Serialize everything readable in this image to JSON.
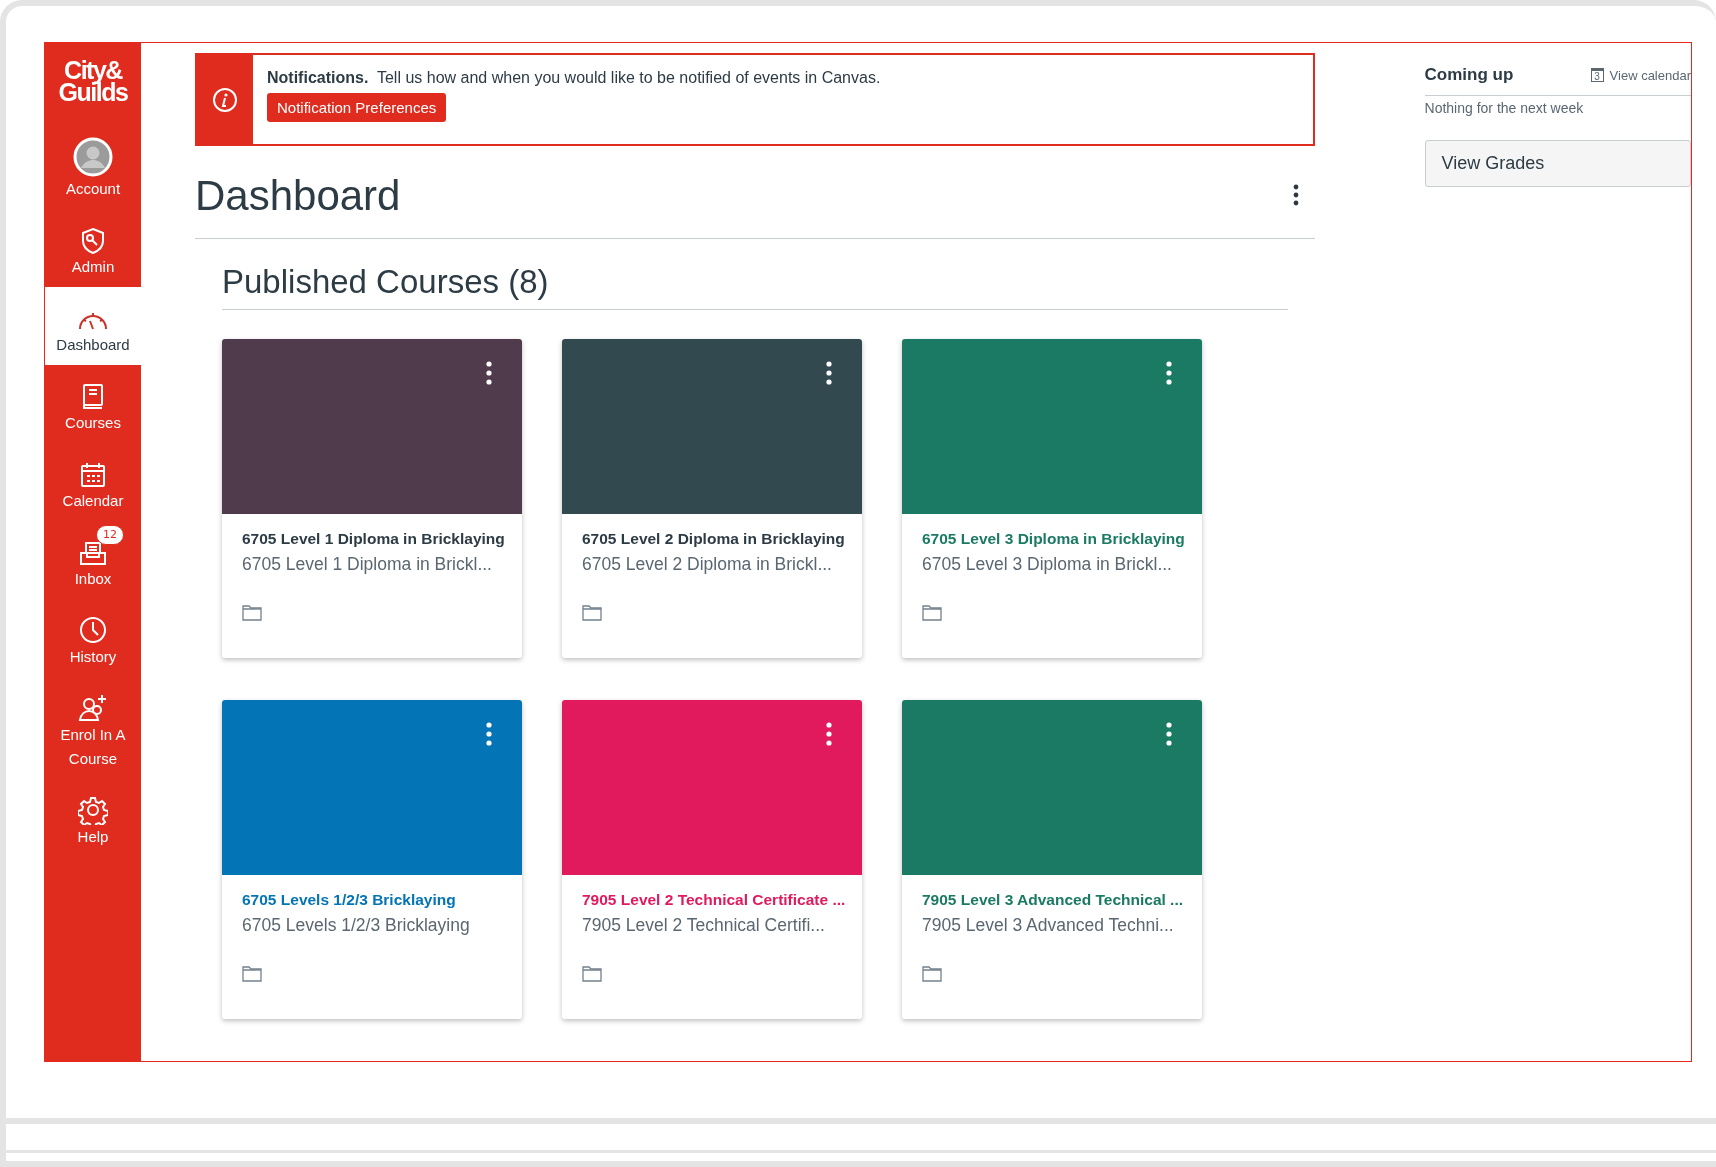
{
  "sidebar": {
    "logo": {
      "line1": "City&",
      "line2": "Guilds"
    },
    "items": [
      {
        "kind": "account",
        "label": "Account",
        "selected": false
      },
      {
        "kind": "admin",
        "label": "Admin",
        "selected": false
      },
      {
        "kind": "dashboard",
        "label": "Dashboard",
        "selected": true
      },
      {
        "kind": "courses",
        "label": "Courses",
        "selected": false
      },
      {
        "kind": "calendar",
        "label": "Calendar",
        "selected": false
      },
      {
        "kind": "inbox",
        "label": "Inbox",
        "selected": false,
        "badge": "12"
      },
      {
        "kind": "history",
        "label": "History",
        "selected": false
      },
      {
        "kind": "enrol",
        "label": "Enrol In A Course",
        "selected": false
      },
      {
        "kind": "help",
        "label": "Help",
        "selected": false
      }
    ]
  },
  "notification": {
    "title": "Notifications.",
    "message": "Tell us how and when you would like to be notified of events in Canvas.",
    "button": "Notification Preferences"
  },
  "page_title": "Dashboard",
  "section_title": "Published Courses (8)",
  "courses": [
    {
      "title": "6705 Level 1 Diploma in Bricklaying",
      "subtitle": "6705 Level 1 Diploma in Brickl...",
      "color": "#4f3b4c",
      "title_colored": false
    },
    {
      "title": "6705 Level 2 Diploma in Bricklaying",
      "subtitle": "6705 Level 2 Diploma in Brickl...",
      "color": "#324a4f",
      "title_colored": false
    },
    {
      "title": "6705 Level 3 Diploma in Bricklaying",
      "subtitle": "6705 Level 3 Diploma in Brickl...",
      "color": "#1b7a63",
      "title_colored": true
    },
    {
      "title": "6705 Levels 1/2/3 Bricklaying",
      "subtitle": "6705 Levels 1/2/3 Bricklaying",
      "color": "#0374b5",
      "title_colored": true
    },
    {
      "title": "7905 Level 2 Technical Certificate ...",
      "subtitle": "7905 Level 2 Technical Certifi...",
      "color": "#e01a5c",
      "title_colored": true
    },
    {
      "title": "7905 Level 3 Advanced Technical ...",
      "subtitle": "7905 Level 3 Advanced Techni...",
      "color": "#1b7a63",
      "title_colored": true
    }
  ],
  "coming_up": {
    "title": "Coming up",
    "calendar_link": "View calendar",
    "calendar_day": "3",
    "empty_message": "Nothing for the next week",
    "grades_button": "View Grades"
  }
}
